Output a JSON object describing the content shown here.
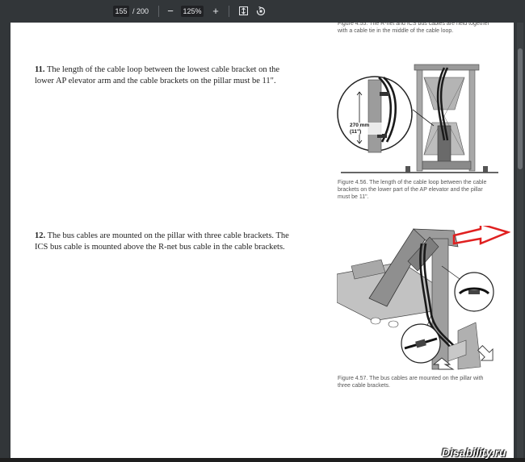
{
  "toolbar": {
    "page_current": "155",
    "page_total": "/ 200",
    "zoom_out": "−",
    "zoom_level": "125%",
    "zoom_in": "+",
    "fit_icon": "fit-page-icon",
    "rotate_icon": "rotate-icon"
  },
  "document": {
    "caption_prev": "Figure 4.55. The R-net and ICS bus cables are held together with a cable tie in the middle of the cable loop.",
    "step11": {
      "number": "11.",
      "text": "The length of the cable loop between the lowest cable bracket on the lower AP elevator arm and the cable brackets on the pillar must be 11\"."
    },
    "figure456": {
      "measure_label": "270 mm (11\")",
      "caption": "Figure 4.56. The length of the cable loop between the cable brackets on the lower part of the AP elevator and the pillar must be 11\"."
    },
    "step12": {
      "number": "12.",
      "text": "The bus cables are mounted on the pillar with three cable brackets. The ICS bus cable is mounted above the R-net bus cable in the cable brackets."
    },
    "figure457": {
      "caption": "Figure 4.57. The bus cables are mounted on the pillar with three cable brackets.",
      "arrow_color": "#e02020"
    }
  },
  "watermark": "Disability.ru"
}
